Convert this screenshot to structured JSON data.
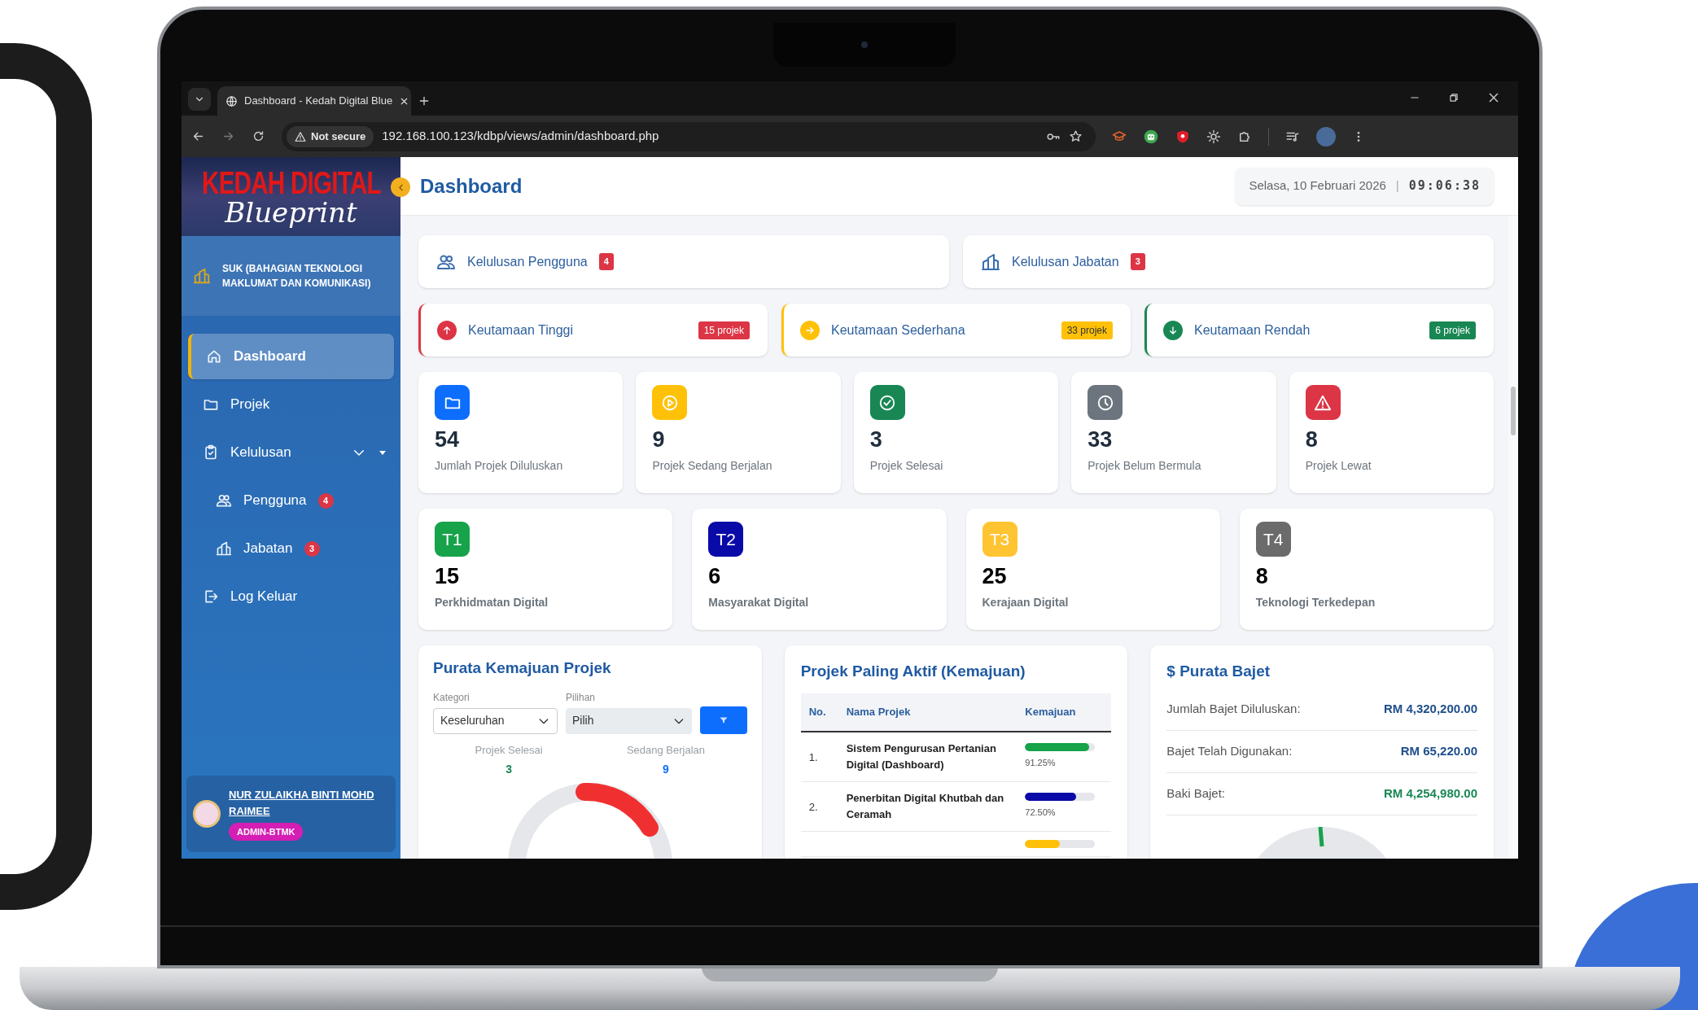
{
  "browser": {
    "tab_title": "Dashboard - Kedah Digital Blue",
    "url_badge": "Not secure",
    "url": "192.168.100.123/kdbp/views/admin/dashboard.php"
  },
  "sidebar": {
    "logo_title": "KEDAH DIGITAL",
    "logo_script": "Blueprint",
    "department": "SUK (BAHAGIAN TEKNOLOGI MAKLUMAT DAN KOMUNIKASI)",
    "nav": [
      {
        "label": "Dashboard",
        "kind": "home",
        "selected": true
      },
      {
        "label": "Projek",
        "kind": "folder",
        "selected": false
      },
      {
        "label": "Kelulusan",
        "kind": "clipboard",
        "selected": false,
        "expanded": true,
        "children": [
          {
            "label": "Pengguna",
            "kind": "users",
            "badge": "4",
            "selected": false
          },
          {
            "label": "Jabatan",
            "kind": "building",
            "badge": "3",
            "selected": false
          }
        ]
      },
      {
        "label": "Log Keluar",
        "kind": "logout",
        "selected": false
      }
    ],
    "user": {
      "name": "NUR ZULAIKHA BINTI MOHD RAIMEE",
      "role": "ADMIN-BTMK"
    }
  },
  "header": {
    "title": "Dashboard",
    "date": "Selasa, 10 Februari 2026",
    "separator": "|",
    "time": "09:06:38"
  },
  "approvals": [
    {
      "label": "Kelulusan Pengguna",
      "count": "4",
      "kind": "users"
    },
    {
      "label": "Kelulusan Jabatan",
      "count": "3",
      "kind": "building"
    }
  ],
  "priorities": [
    {
      "label": "Keutamaan Tinggi",
      "badge": "15 projek",
      "color": "#dc3545",
      "kind": "up"
    },
    {
      "label": "Keutamaan Sederhana",
      "badge": "33 projek",
      "color": "#ffc107",
      "kind": "right"
    },
    {
      "label": "Keutamaan Rendah",
      "badge": "6 projek",
      "color": "#198754",
      "kind": "down"
    }
  ],
  "stats": [
    {
      "value": "54",
      "label": "Jumlah Projek Diluluskan",
      "color": "#0d6efd",
      "kind": "folder"
    },
    {
      "value": "9",
      "label": "Projek Sedang Berjalan",
      "color": "#ffc107",
      "kind": "play"
    },
    {
      "value": "3",
      "label": "Projek Selesai",
      "color": "#198754",
      "kind": "check"
    },
    {
      "value": "33",
      "label": "Projek Belum Bermula",
      "color": "#6c757d",
      "kind": "clock"
    },
    {
      "value": "8",
      "label": "Projek Lewat",
      "color": "#dc3545",
      "kind": "warning"
    }
  ],
  "themes": [
    {
      "code": "T1",
      "value": "15",
      "label": "Perkhidmatan Digital",
      "color": "#16a34a"
    },
    {
      "code": "T2",
      "value": "6",
      "label": "Masyarakat Digital",
      "color": "#0a0aa8"
    },
    {
      "code": "T3",
      "value": "25",
      "label": "Kerajaan Digital",
      "color": "#ffc431"
    },
    {
      "code": "T4",
      "value": "8",
      "label": "Teknologi Terkedepan",
      "color": "#6b6b6b"
    }
  ],
  "progress_panel": {
    "title": "Purata Kemajuan Projek",
    "category_label": "Kategori",
    "category_value": "Keseluruhan",
    "option_label": "Pilihan",
    "option_value": "Pilih",
    "summary": [
      {
        "label": "Projek Selesai",
        "value": "3",
        "color": "#198754"
      },
      {
        "label": "Sedang Berjalan",
        "value": "9",
        "color": "#0d6efd"
      }
    ]
  },
  "active_projects": {
    "title": "Projek Paling Aktif (Kemajuan)",
    "columns": [
      "No.",
      "Nama Projek",
      "Kemajuan"
    ],
    "rows": [
      {
        "no": "1.",
        "name": "Sistem Pengurusan Pertanian Digital (Dashboard)",
        "level": 0.9125,
        "percent": "91.25%",
        "color": "#16a34a"
      },
      {
        "no": "2.",
        "name": "Penerbitan Digital Khutbah dan Ceramah",
        "level": 0.725,
        "percent": "72.50%",
        "color": "#0a0aa8"
      },
      {
        "level": 0.5,
        "color": "#ffc107"
      }
    ]
  },
  "budget": {
    "title": "$ Purata Bajet",
    "rows": [
      {
        "label": "Jumlah Bajet Diluluskan:",
        "value": "RM 4,320,200.00",
        "color": "#1e4e8c"
      },
      {
        "label": "Bajet Telah Digunakan:",
        "value": "RM 65,220.00",
        "color": "#1e4e8c"
      },
      {
        "label": "Baki Bajet:",
        "value": "RM 4,254,980.00",
        "color": "#198754"
      }
    ]
  }
}
